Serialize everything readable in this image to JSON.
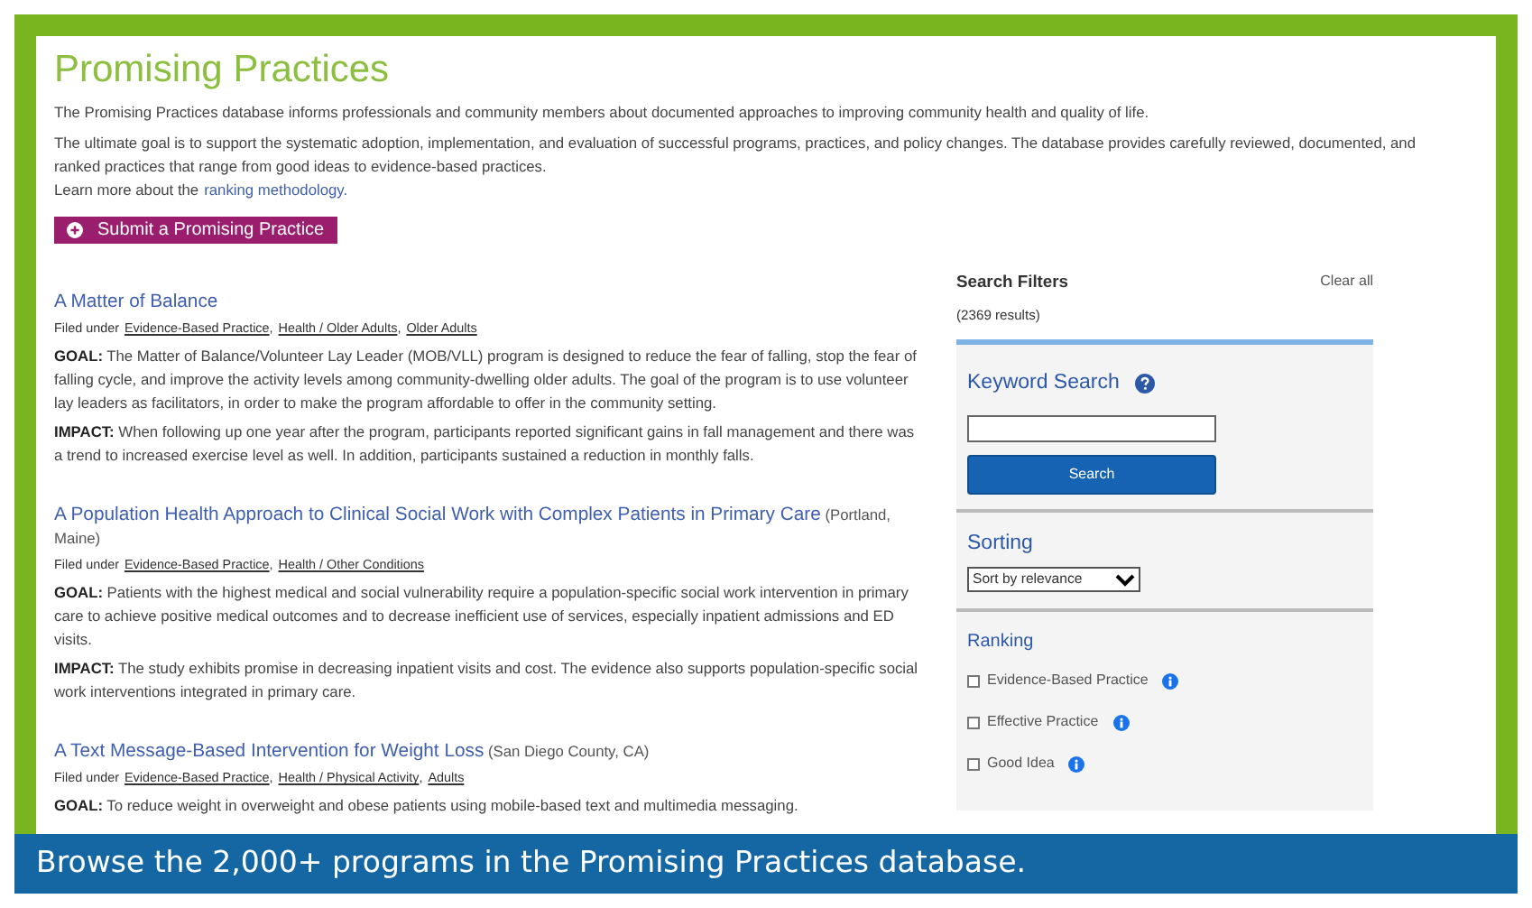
{
  "header": {
    "title": "Promising Practices",
    "intro": "The Promising Practices database informs professionals and community members about documented approaches to improving community health and quality of life.",
    "goal_text": "The ultimate goal is to support the systematic adoption, implementation, and evaluation of successful programs, practices, and policy changes. The database provides carefully reviewed, documented, and ranked practices that range from good ideas to evidence-based practices.",
    "learn_more": "Learn more about the",
    "learn_more_link": "ranking methodology.",
    "submit_button": "Submit a Promising Practice"
  },
  "practices": [
    {
      "title": "A Matter of Balance",
      "filed_label": "Filed under",
      "separator": ",",
      "tags": [
        "Evidence-Based Practice",
        "Health / Older Adults",
        "Older Adults"
      ],
      "paragraphs": [
        "**GOAL:** The Matter of Balance/Volunteer Lay Leader (MOB/VLL) program is designed to reduce the fear of falling, stop the fear of falling cycle, and improve the activity levels among community-dwelling older adults. The goal of the program is to use volunteer lay leaders as facilitators, in order to make the program affordable to offer in the community setting.",
        "**IMPACT:** When following up one year after the program, participants reported significant gains in fall management and there was a trend to increased exercise level as well. In addition, participants sustained a reduction in monthly falls."
      ]
    },
    {
      "title": "A Population Health Approach to Clinical Social Work with Complex Patients in Primary Care",
      "location": "(Portland, Maine)",
      "filed_label": "Filed under",
      "separator": ",",
      "tags": [
        "Evidence-Based Practice",
        "Health / Other Conditions"
      ],
      "paragraphs": [
        "**GOAL:** Patients with the highest medical and social vulnerability require a population-specific social work intervention in primary care to achieve positive medical outcomes and to decrease inefficient use of services, especially inpatient admissions and ED visits.",
        "**IMPACT:** The study exhibits promise in decreasing inpatient visits and cost. The evidence also supports population-specific social work interventions integrated in primary care."
      ]
    },
    {
      "title": "A Text Message-Based Intervention for Weight Loss",
      "location": "(San Diego County, CA)",
      "filed_label": "Filed under",
      "separator": ",",
      "tags": [
        "Evidence-Based Practice",
        "Health / Physical Activity",
        "Adults"
      ],
      "paragraphs": [
        "**GOAL:** To reduce weight in overweight and obese patients using mobile-based text and multimedia messaging."
      ]
    }
  ],
  "filters": {
    "title": "Search Filters",
    "clear_all": "Clear all",
    "results": "(2369 results)",
    "keyword_heading": "Keyword Search",
    "search_button": "Search",
    "sorting_heading": "Sorting",
    "sort_value": "Sort by relevance",
    "ranking_heading": "Ranking",
    "ranking_options": [
      {
        "label": "Evidence-Based Practice",
        "checked": false
      },
      {
        "label": "Effective Practice",
        "checked": false
      },
      {
        "label": "Good Idea",
        "checked": false
      }
    ]
  },
  "caption": "Browse the 2,000+ programs in the Promising Practices database."
}
